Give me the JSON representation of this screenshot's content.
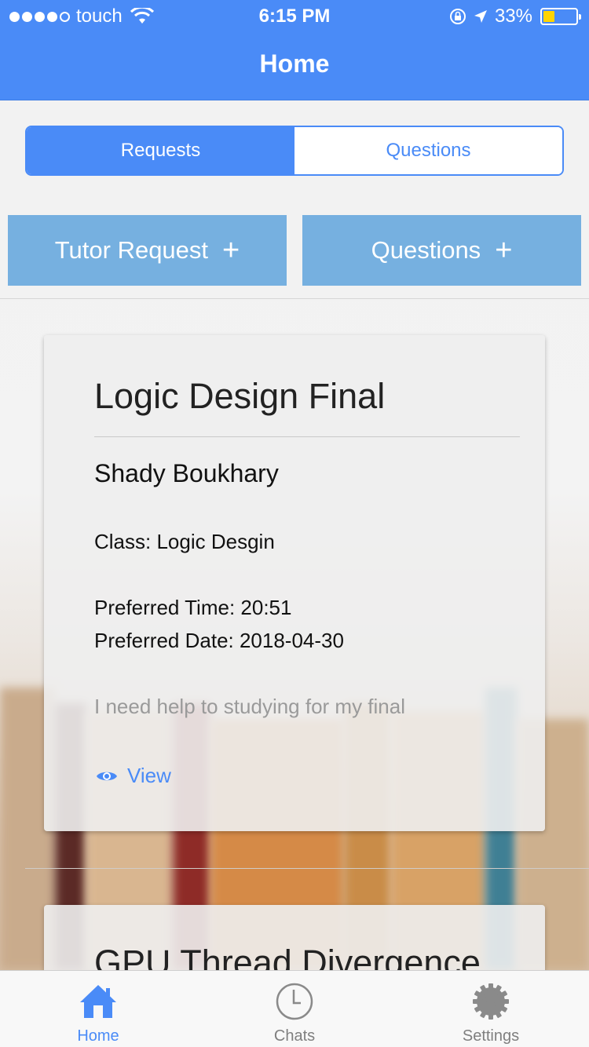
{
  "status_bar": {
    "carrier": "touch",
    "time": "6:15 PM",
    "battery": "33%"
  },
  "nav": {
    "title": "Home"
  },
  "segment": {
    "requests": "Requests",
    "questions": "Questions",
    "selected": "Requests"
  },
  "actions": {
    "tutor_request": "Tutor Request",
    "questions": "Questions",
    "plus": "+"
  },
  "cards": [
    {
      "title": "Logic Design Final",
      "name": "Shady Boukhary",
      "class": "Class: Logic Desgin",
      "preferred_time": "Preferred Time: 20:51",
      "preferred_date": "Preferred Date: 2018-04-30",
      "description": "I need help to studying for my final",
      "view_label": "View"
    },
    {
      "title": "GPU Thread Divergence"
    }
  ],
  "tabs": [
    {
      "label": "Home",
      "icon": "home-icon",
      "active": true
    },
    {
      "label": "Chats",
      "icon": "clock-icon",
      "active": false
    },
    {
      "label": "Settings",
      "icon": "gear-icon",
      "active": false
    }
  ],
  "colors": {
    "accent": "#4a8bf7",
    "action_button": "#76b0e0",
    "battery_fill": "#ffd400"
  }
}
